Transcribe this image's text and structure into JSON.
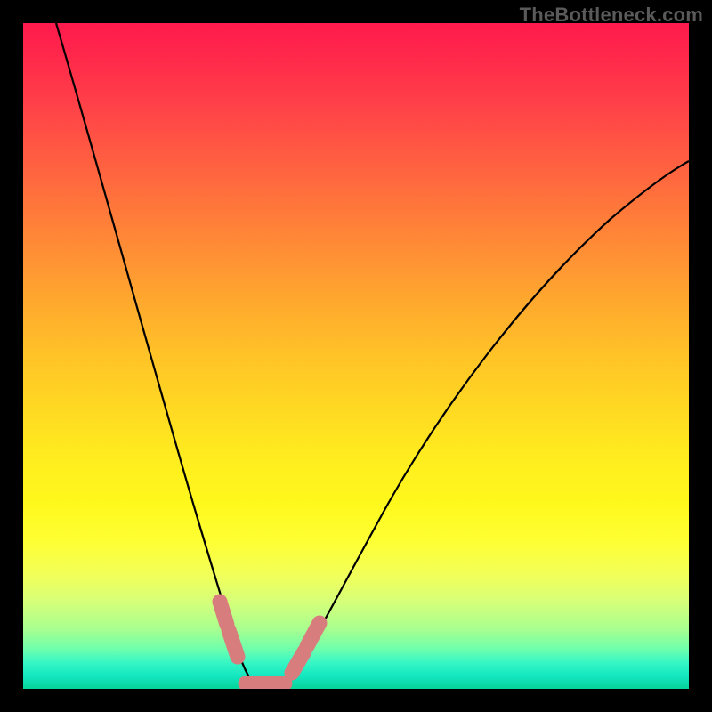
{
  "watermark": "TheBottleneck.com",
  "colors": {
    "frame": "#000000",
    "curve": "#000000",
    "highlight": "#d87d7d"
  },
  "chart_data": {
    "type": "line",
    "title": "",
    "xlabel": "",
    "ylabel": "",
    "xlim": [
      0,
      100
    ],
    "ylim": [
      0,
      100
    ],
    "grid": false,
    "legend": false,
    "series": [
      {
        "name": "bottleneck-curve",
        "x": [
          5,
          10,
          15,
          20,
          25,
          27,
          29,
          31,
          33,
          34.8,
          36,
          38,
          40,
          45,
          50,
          55,
          60,
          65,
          70,
          75,
          80,
          85,
          90,
          95,
          100
        ],
        "y": [
          100,
          84,
          67,
          48,
          26,
          16,
          8,
          3,
          1,
          0,
          0,
          1,
          3,
          9,
          17,
          25,
          33,
          41,
          48,
          54,
          60,
          65,
          69,
          73,
          76
        ]
      }
    ],
    "annotations": [
      {
        "kind": "highlight-segment",
        "x_range": [
          26,
          30
        ],
        "note": "left pink marker cluster"
      },
      {
        "kind": "highlight-segment",
        "x_range": [
          31,
          37
        ],
        "note": "valley floor pink marker"
      },
      {
        "kind": "highlight-segment",
        "x_range": [
          38,
          42
        ],
        "note": "right pink marker cluster"
      }
    ],
    "description": "Single V-shaped curve on a rainbow vertical gradient background (red top → green bottom), inside a black border. Minimum near x≈35%. Pink rounded segments highlight the valley region. No axes, ticks, or numeric labels are visible."
  }
}
